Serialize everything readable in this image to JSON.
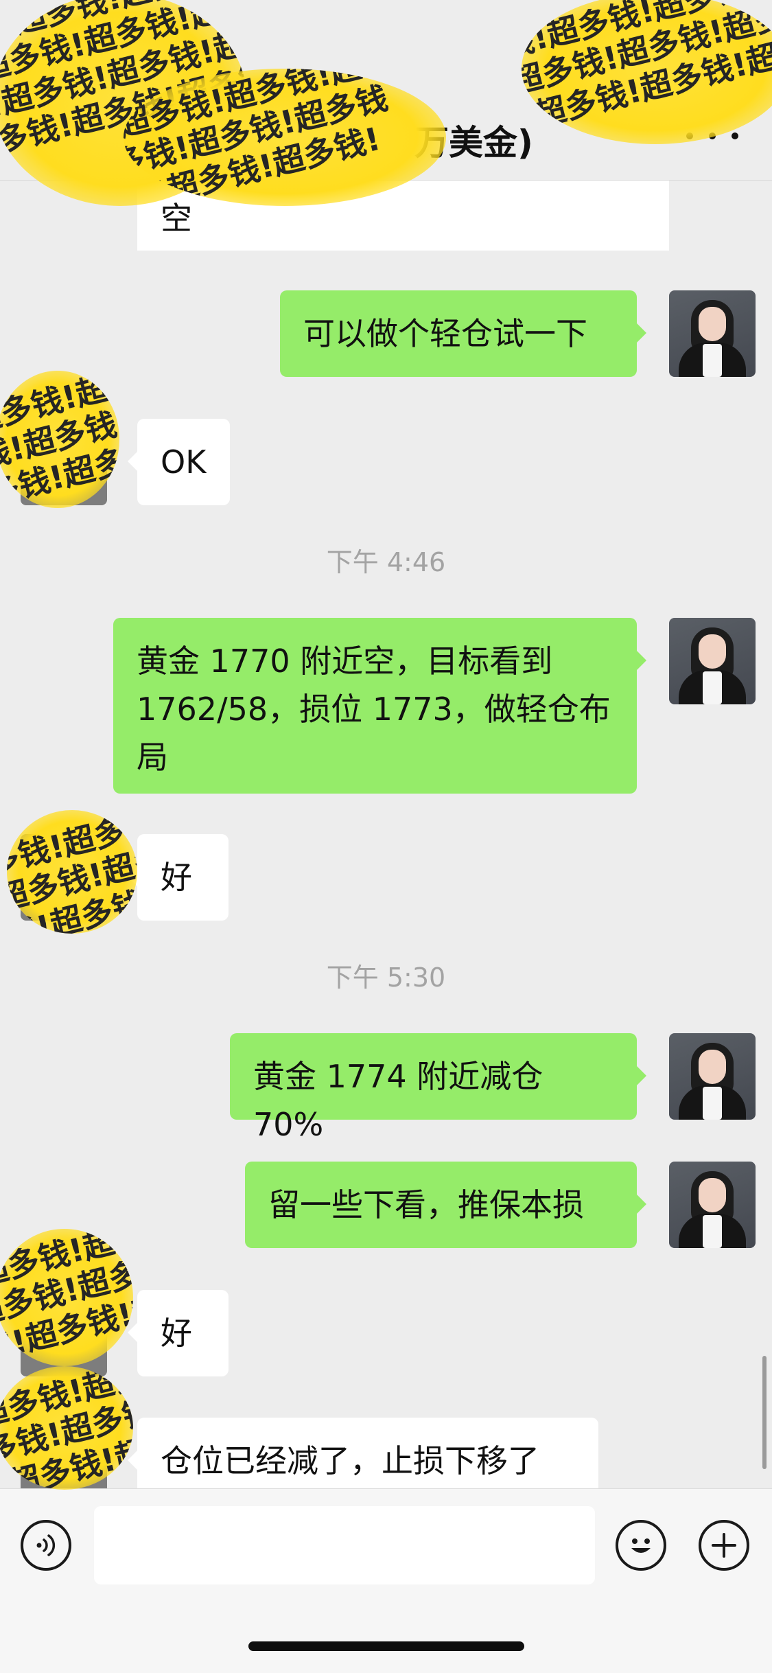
{
  "header": {
    "title_visible": "万美金)",
    "more_icon": "ellipsis-icon"
  },
  "messages": [
    {
      "id": "m0",
      "side": "in",
      "text": "空",
      "partial_top": true
    },
    {
      "id": "m1",
      "side": "out",
      "text": "可以做个轻仓试一下"
    },
    {
      "id": "m2",
      "side": "in",
      "text": "OK"
    },
    {
      "id": "t1",
      "type": "time",
      "text": "下午 4:46"
    },
    {
      "id": "m3",
      "side": "out",
      "text": "黄金 1770 附近空，目标看到 1762/58，损位 1773，做轻仓布局"
    },
    {
      "id": "m4",
      "side": "in",
      "text": "好"
    },
    {
      "id": "t2",
      "type": "time",
      "text": "下午 5:30"
    },
    {
      "id": "m5",
      "side": "out",
      "text": "黄金 1774 附近减仓 70%"
    },
    {
      "id": "m6",
      "side": "out",
      "text": "留一些下看，推保本损"
    },
    {
      "id": "m7",
      "side": "in",
      "text": "好"
    },
    {
      "id": "m8",
      "side": "in",
      "text": "仓位已经减了，止损下移了",
      "partial_bottom": true
    }
  ],
  "watermark": {
    "text_rows": [
      "钱!超多钱!超多钱!",
      "超多钱!超多钱!超多",
      "!超多钱!超多钱!超",
      "多钱!超多钱!超多钱"
    ],
    "color": "#ffdd1f"
  },
  "input_bar": {
    "voice_icon": "voice-icon",
    "emoji_icon": "emoji-icon",
    "plus_icon": "plus-icon",
    "input_value": ""
  },
  "colors": {
    "background": "#ededed",
    "outgoing_bubble": "#95ec69",
    "incoming_bubble": "#ffffff",
    "timestamp": "#a3a3a3"
  }
}
